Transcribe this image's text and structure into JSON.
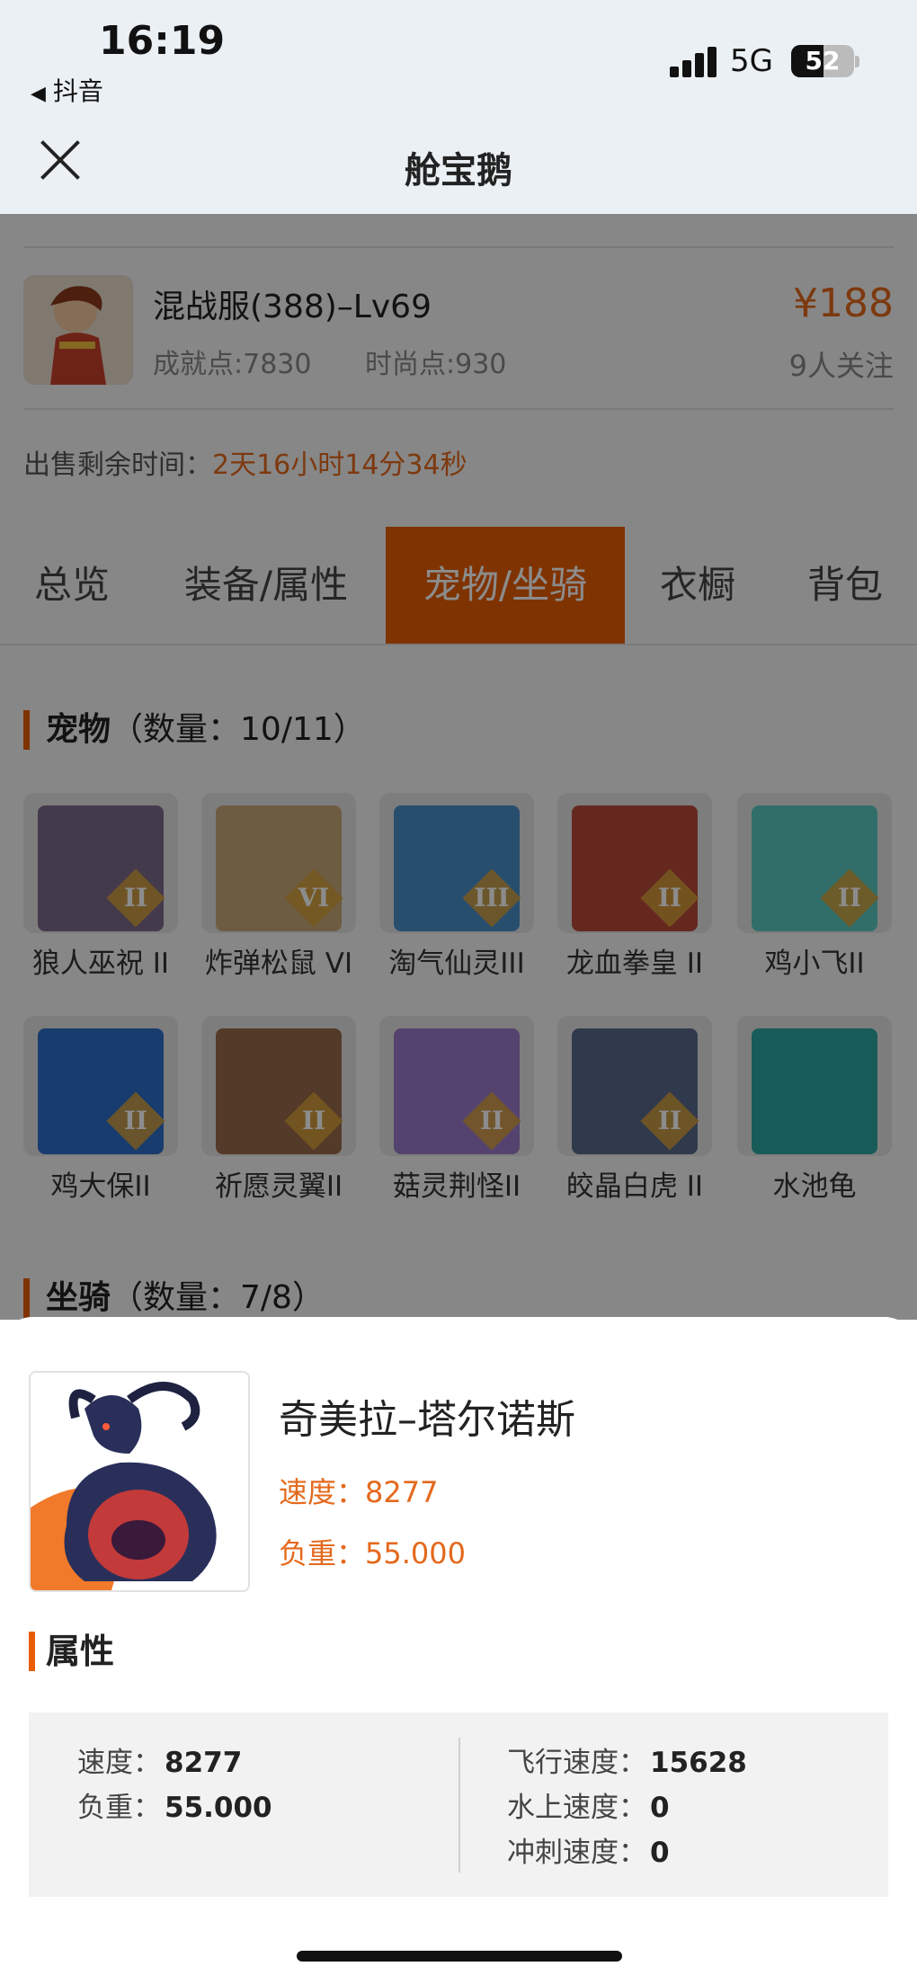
{
  "status_bar": {
    "time": "16:19",
    "back_app": "抖音",
    "network": "5G",
    "battery": "52",
    "battery_level": 0.52
  },
  "nav": {
    "title": "舱宝鹅"
  },
  "account": {
    "name": "混战服(388)–Lv69",
    "achievement": "成就点:7830",
    "fashion": "时尚点:930",
    "price": "¥188",
    "watchers": "9人关注",
    "sell_time_label": "出售剩余时间：",
    "sell_time_value": "2天16小时14分34秒"
  },
  "tabs": [
    {
      "label": "总览"
    },
    {
      "label": "装备/属性"
    },
    {
      "label": "宠物/坐骑",
      "active": true
    },
    {
      "label": "衣橱"
    },
    {
      "label": "背包"
    }
  ],
  "pets_section": {
    "title": "宠物",
    "count": "（数量：10/11）"
  },
  "pets": [
    {
      "name": "狼人巫祝 II",
      "rank": "II",
      "color": "#7a6a8a"
    },
    {
      "name": "炸弹松鼠 VI",
      "rank": "VI",
      "color": "#c8a878"
    },
    {
      "name": "淘气仙灵III",
      "rank": "III",
      "color": "#4a8ec8"
    },
    {
      "name": "龙血拳皇 II",
      "rank": "II",
      "color": "#b84a3a"
    },
    {
      "name": "鸡小飞II",
      "rank": "II",
      "color": "#5ac8c0"
    },
    {
      "name": "鸡大保II",
      "rank": "II",
      "color": "#2e6ec8"
    },
    {
      "name": "祈愿灵翼II",
      "rank": "II",
      "color": "#9a6a4a"
    },
    {
      "name": "菇灵荆怪II",
      "rank": "II",
      "color": "#9a7ac8"
    },
    {
      "name": "皎晶白虎 II",
      "rank": "II",
      "color": "#5a6a8a"
    },
    {
      "name": "水池龟",
      "rank": "",
      "color": "#2aa8a0"
    }
  ],
  "mounts_section": {
    "title": "坐骑",
    "count": "（数量：7/8）"
  },
  "sheet": {
    "mount_name": "奇美拉–塔尔诺斯",
    "speed_line": "速度：8277",
    "load_line": "负重：55.000",
    "attr_title": "属性",
    "attrs_left": [
      {
        "label": "速度：",
        "value": "8277"
      },
      {
        "label": "负重：",
        "value": "55.000"
      }
    ],
    "attrs_right": [
      {
        "label": "飞行速度：",
        "value": "15628"
      },
      {
        "label": "水上速度：",
        "value": "0"
      },
      {
        "label": "冲刺速度：",
        "value": "0"
      }
    ]
  }
}
